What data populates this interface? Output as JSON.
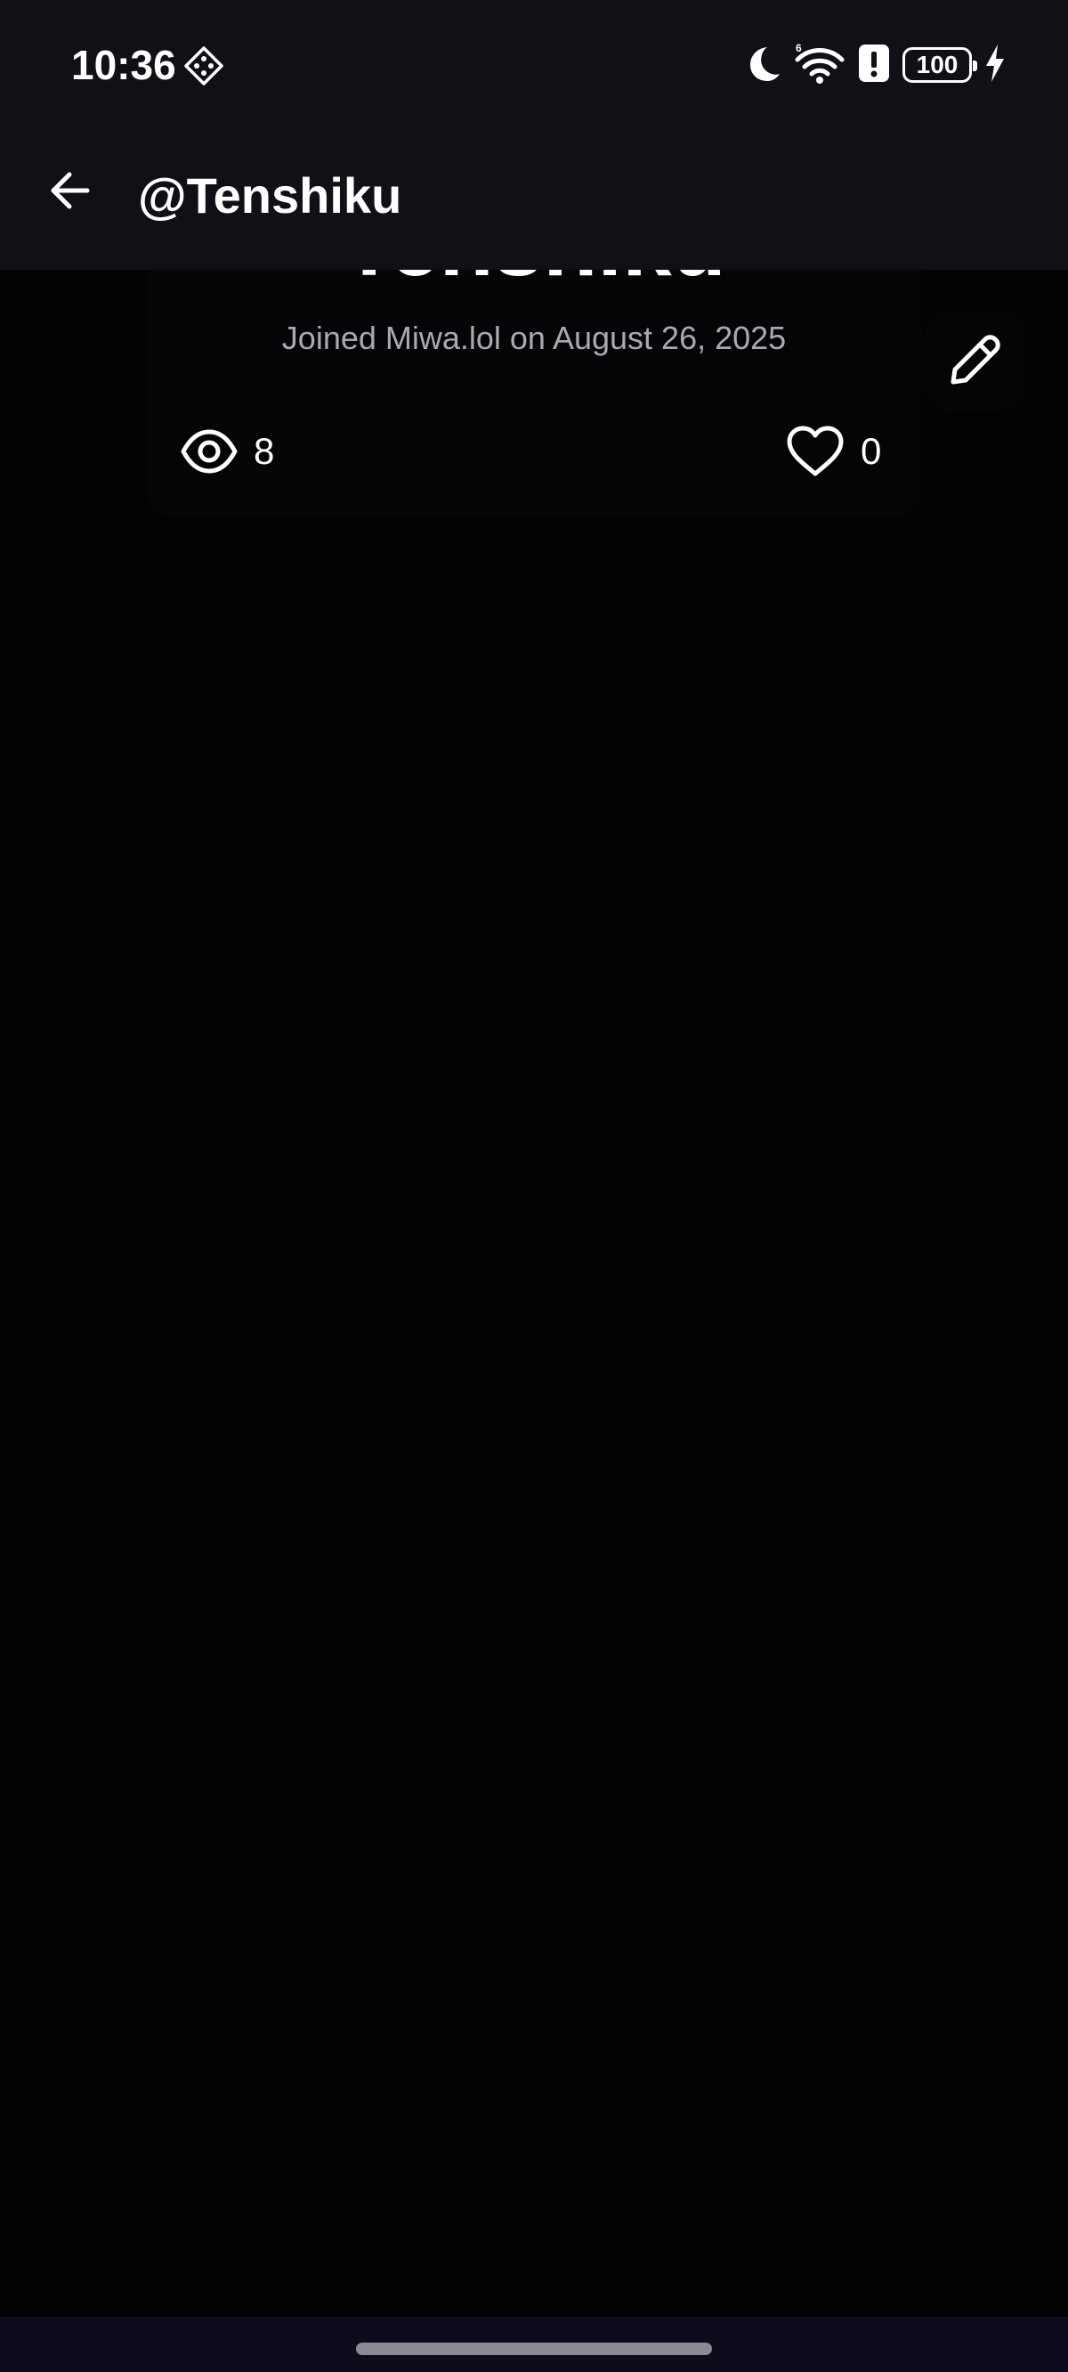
{
  "status_bar": {
    "time": "10:36",
    "battery_level": "100",
    "icons": [
      "game-mode-icon",
      "do-not-disturb-moon-icon",
      "wifi-6-icon",
      "alert-icon",
      "battery-icon",
      "charging-bolt-icon"
    ]
  },
  "app_bar": {
    "title": "@Tenshiku",
    "back_icon": "arrow-left-icon"
  },
  "profile": {
    "display_name": "Tenshiku",
    "joined_text": "Joined Miwa.lol on August 26, 2025",
    "views": {
      "icon": "eye-icon",
      "count": "8"
    },
    "likes": {
      "icon": "heart-outline-icon",
      "count": "0"
    },
    "edit_icon": "pencil-icon"
  },
  "colors": {
    "background": "#030305",
    "app_bar": "#101016",
    "text_primary": "#ffffff",
    "text_secondary": "#a9a9b1",
    "nav_bar": "#0c0c1c"
  }
}
